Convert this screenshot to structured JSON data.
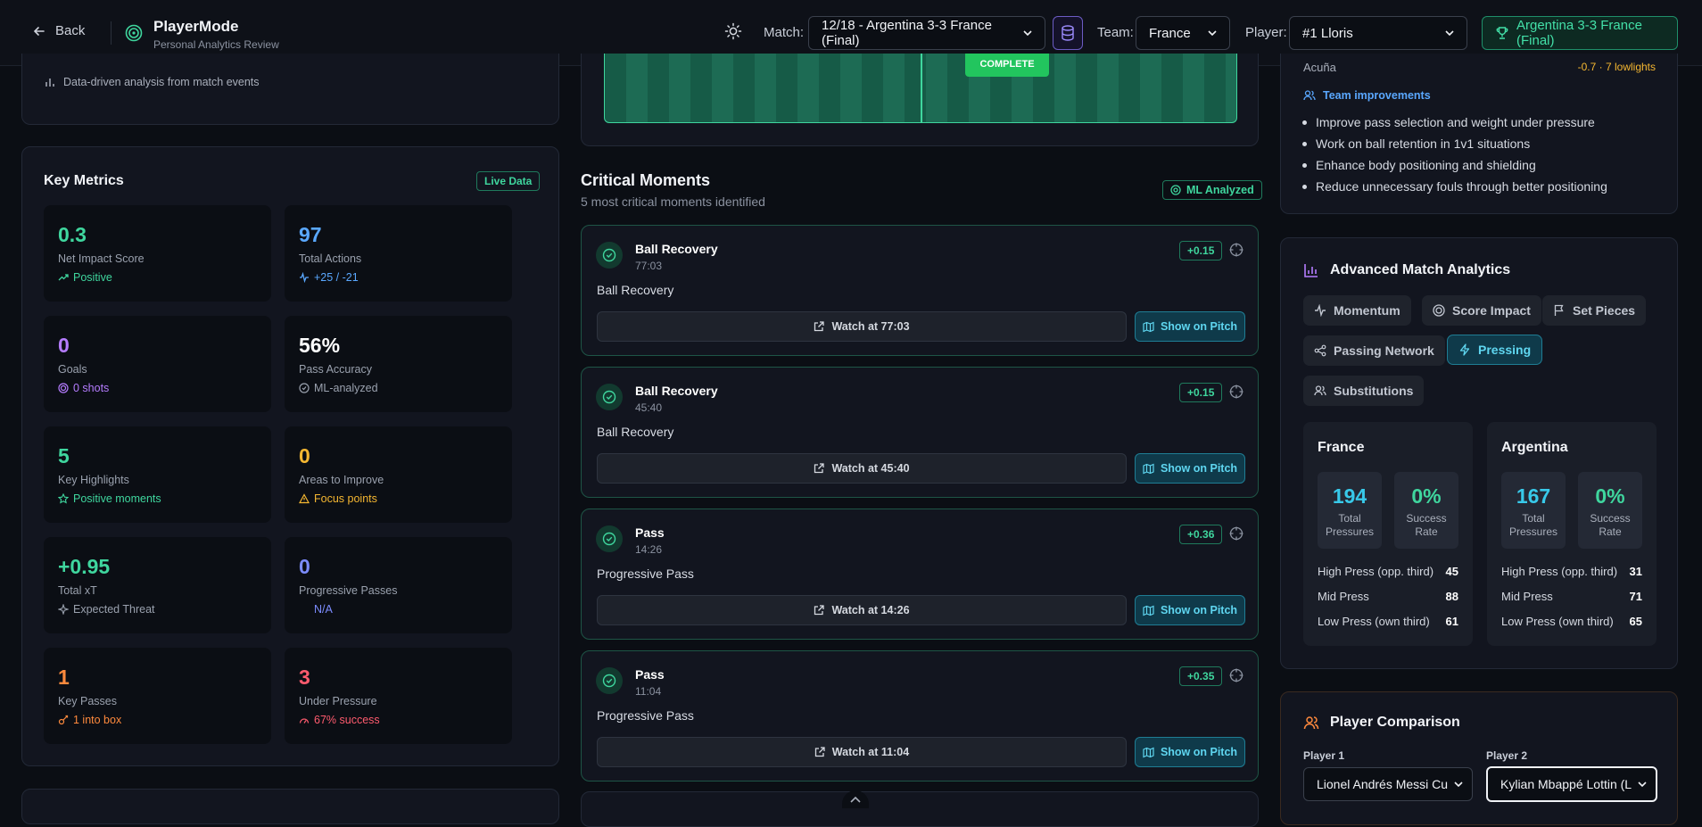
{
  "header": {
    "back_label": "Back",
    "app_title": "PlayerMode",
    "app_subtitle": "Personal Analytics Review",
    "match_label": "Match:",
    "match_value": "12/18 - Argentina 3-3 France (Final)",
    "team_label": "Team:",
    "team_value": "France",
    "player_label": "Player:",
    "player_value": "#1 Lloris",
    "match_pill": "Argentina 3-3 France (Final)"
  },
  "left": {
    "data_note": "Data-driven analysis from match events",
    "metrics_title": "Key Metrics",
    "live_badge": "Live Data",
    "metrics": [
      {
        "value": "0.3",
        "label": "Net Impact Score",
        "sub": "Positive",
        "color": "#3fd69e"
      },
      {
        "value": "97",
        "label": "Total Actions",
        "sub": "+25 / -21",
        "color": "#5aa8ff"
      },
      {
        "value": "0",
        "label": "Goals",
        "sub": "0 shots",
        "color": "#b57cff"
      },
      {
        "value": "56%",
        "label": "Pass Accuracy",
        "sub": "ML-analyzed",
        "color": "#ffffff"
      },
      {
        "value": "5",
        "label": "Key Highlights",
        "sub": "Positive moments",
        "color": "#3fd69e"
      },
      {
        "value": "0",
        "label": "Areas to Improve",
        "sub": "Focus points",
        "color": "#f5b731"
      },
      {
        "value": "+0.95",
        "label": "Total xT",
        "sub": "Expected Threat",
        "color": "#3fd69e"
      },
      {
        "value": "0",
        "label": "Progressive Passes",
        "sub": "N/A",
        "color": "#7c8cff"
      },
      {
        "value": "1",
        "label": "Key Passes",
        "sub": "1 into box",
        "color": "#ff8a3d"
      },
      {
        "value": "3",
        "label": "Under Pressure",
        "sub": "67% success",
        "color": "#ff5b6e"
      }
    ]
  },
  "middle": {
    "pitch_badge": "COMPLETE",
    "critical_title": "Critical Moments",
    "critical_sub": "5 most critical moments identified",
    "ml_badge": "ML Analyzed",
    "show_pitch_label": "Show on Pitch",
    "moments": [
      {
        "title": "Ball Recovery",
        "time": "77:03",
        "desc": "Ball Recovery",
        "score": "+0.15",
        "watch": "Watch at 77:03"
      },
      {
        "title": "Ball Recovery",
        "time": "45:40",
        "desc": "Ball Recovery",
        "score": "+0.15",
        "watch": "Watch at 45:40"
      },
      {
        "title": "Pass",
        "time": "14:26",
        "desc": "Progressive Pass",
        "score": "+0.36",
        "watch": "Watch at 14:26"
      },
      {
        "title": "Pass",
        "time": "11:04",
        "desc": "Progressive Pass",
        "score": "+0.35",
        "watch": "Watch at 11:04"
      }
    ]
  },
  "right": {
    "acuna_name": "Acuña",
    "acuna_stat": "-0.7 · 7 lowlights",
    "team_improvements_title": "Team improvements",
    "improvements": [
      "Improve pass selection and weight under pressure",
      "Work on ball retention in 1v1 situations",
      "Enhance body positioning and shielding",
      "Reduce unnecessary fouls through better positioning"
    ],
    "analytics_title": "Advanced Match Analytics",
    "tabs": [
      "Momentum",
      "Score Impact",
      "Set Pieces",
      "Passing Network",
      "Pressing",
      "Substitutions"
    ],
    "teams": [
      {
        "name": "France",
        "total": "194",
        "total_label": "Total Pressures",
        "success": "0%",
        "success_label": "Success Rate",
        "rows": [
          {
            "k": "High Press (opp. third)",
            "v": "45"
          },
          {
            "k": "Mid Press",
            "v": "88"
          },
          {
            "k": "Low Press (own third)",
            "v": "61"
          }
        ]
      },
      {
        "name": "Argentina",
        "total": "167",
        "total_label": "Total Pressures",
        "success": "0%",
        "success_label": "Success Rate",
        "rows": [
          {
            "k": "High Press (opp. third)",
            "v": "31"
          },
          {
            "k": "Mid Press",
            "v": "71"
          },
          {
            "k": "Low Press (own third)",
            "v": "65"
          }
        ]
      }
    ],
    "comparison_title": "Player Comparison",
    "player1_label": "Player 1",
    "player1_value": "Lionel Andrés Messi Cu",
    "player2_label": "Player 2",
    "player2_value": "Kylian Mbappé Lottin (L"
  }
}
